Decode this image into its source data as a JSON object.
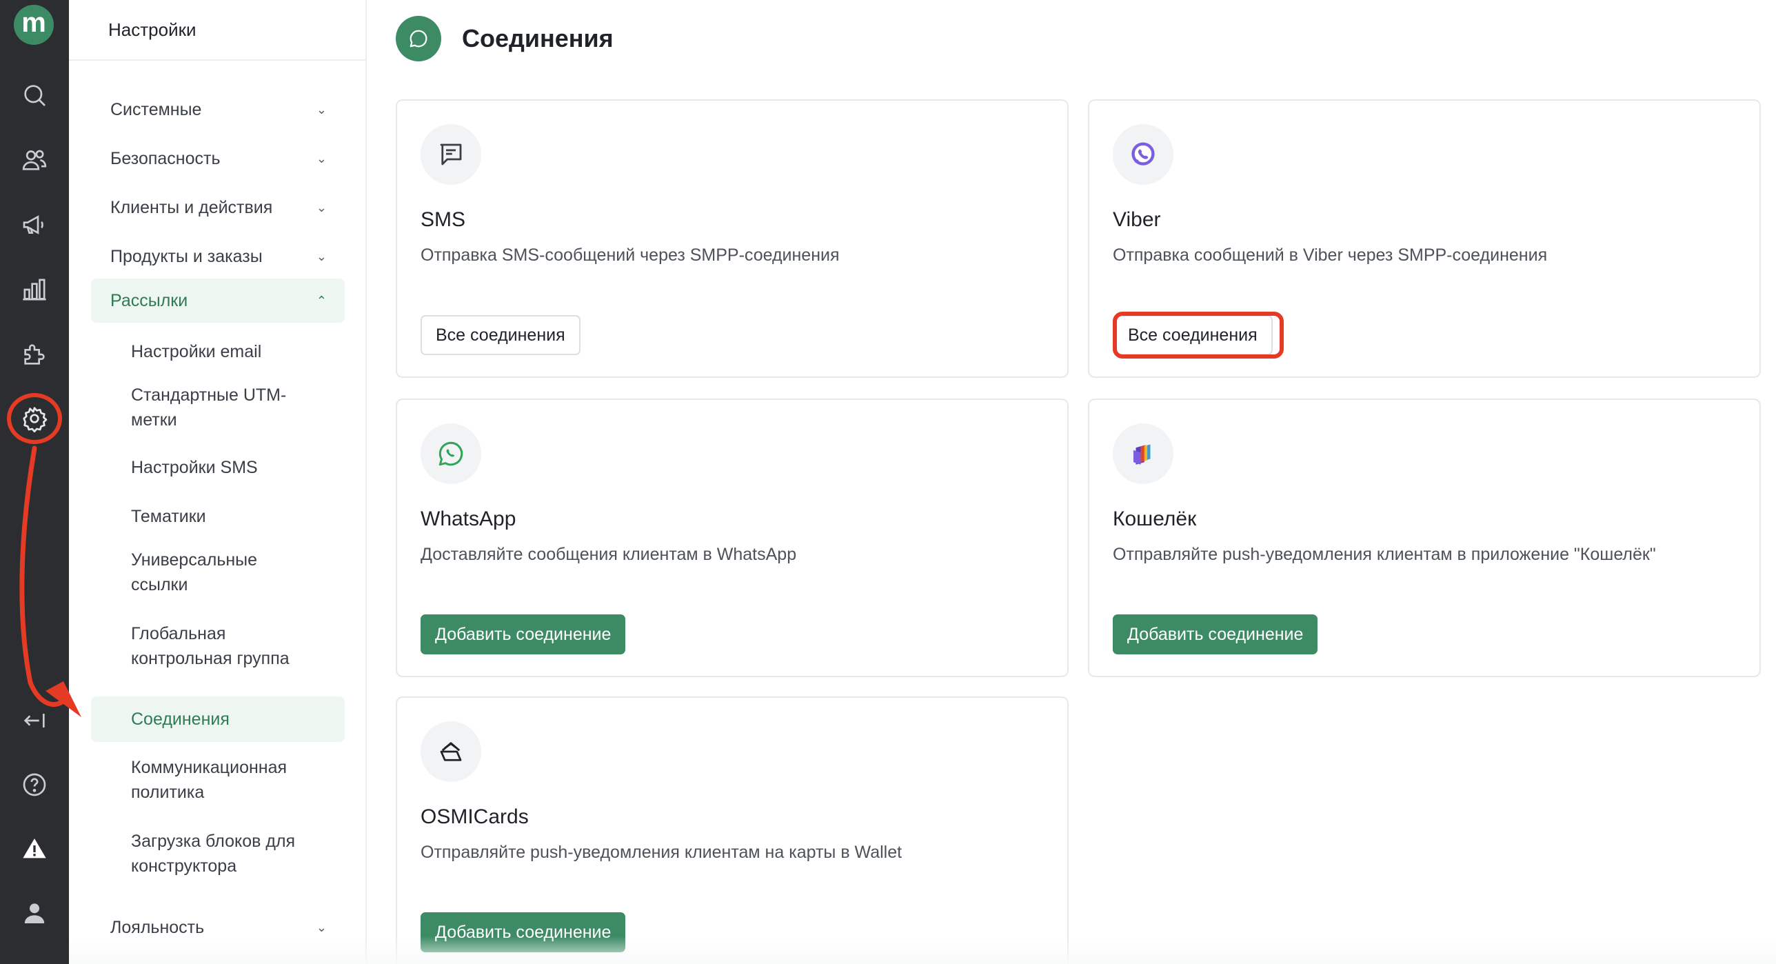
{
  "rail": {
    "logo_letter": "m",
    "items": [
      "search-icon",
      "users-icon",
      "megaphone-icon",
      "bar-chart-icon",
      "puzzle-icon",
      "settings-icon"
    ],
    "bottom_items": [
      "collapse-icon",
      "help-icon",
      "warning-icon",
      "user-icon"
    ]
  },
  "sidebar": {
    "title": "Настройки",
    "sections": [
      {
        "label": "Системные",
        "expanded": false
      },
      {
        "label": "Безопасность",
        "expanded": false
      },
      {
        "label": "Клиенты и действия",
        "expanded": false
      },
      {
        "label": "Продукты и заказы",
        "expanded": false
      },
      {
        "label": "Рассылки",
        "expanded": true
      },
      {
        "label": "Лояльность",
        "expanded": false
      }
    ],
    "sub_items": [
      {
        "line1": "Настройки email",
        "line2": ""
      },
      {
        "line1": "Стандартные UTM-",
        "line2": "метки"
      },
      {
        "line1": "Настройки SMS",
        "line2": ""
      },
      {
        "line1": "Тематики",
        "line2": ""
      },
      {
        "line1": "Универсальные",
        "line2": "ссылки"
      },
      {
        "line1": "Глобальная",
        "line2": "контрольная группа"
      },
      {
        "line1": "Соединения",
        "line2": ""
      },
      {
        "line1": "Коммуникационная",
        "line2": "политика"
      },
      {
        "line1": "Загрузка блоков для",
        "line2": "конструктора"
      }
    ],
    "active_sub_item": "Соединения"
  },
  "main": {
    "title": "Соединения",
    "cards": [
      {
        "title": "SMS",
        "description": "Отправка SMS-сообщений через SMPP-соединения",
        "button": "Все соединения",
        "icon": "message-icon"
      },
      {
        "title": "Viber",
        "description": "Отправка сообщений в Viber через SMPP-соединения",
        "button": "Все соединения",
        "icon": "viber-icon"
      },
      {
        "title": "WhatsApp",
        "description": "Доставляйте сообщения клиентам в WhatsApp",
        "button": "Добавить соединение",
        "icon": "whatsapp-icon"
      },
      {
        "title": "Кошелёк",
        "description": "Отправляйте push-уведомления клиентам в приложение \"Кошелёк\"",
        "button": "Добавить соединение",
        "icon": "wallet-app-icon"
      },
      {
        "title": "OSMICards",
        "description": "Отправляйте push-уведомления клиентам на карты в Wallet",
        "button": "Добавить соединение",
        "icon": "cards-icon"
      }
    ]
  },
  "colors": {
    "rail_bg": "#2b2d31",
    "accent": "#3d8b65",
    "annotation": "#e53a24",
    "active_bg": "#edf6f0"
  }
}
